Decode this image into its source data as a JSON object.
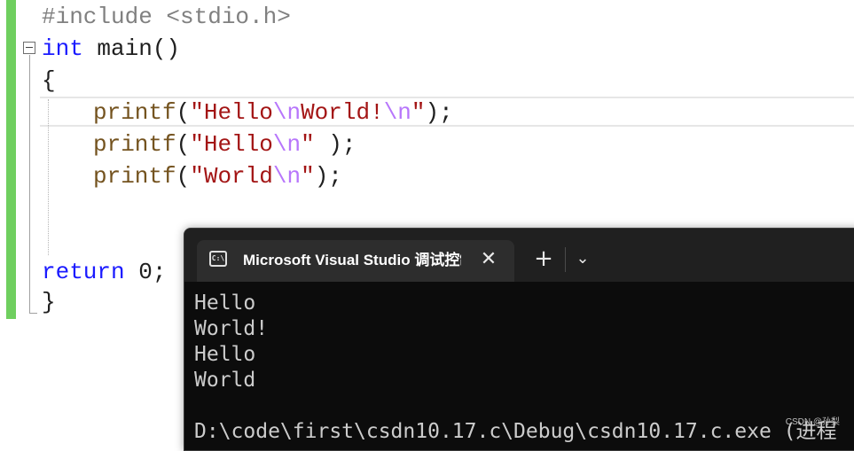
{
  "editor": {
    "line1": {
      "pre": "#include <stdio.h>"
    },
    "line2": {
      "kw": "int",
      "rest": " main()"
    },
    "line3": {
      "brace": "{"
    },
    "line4": {
      "fn": "printf",
      "p1": "(",
      "q1": "\"",
      "s1": "Hello",
      "e1": "\\n",
      "s2": "World!",
      "e2": "\\n",
      "q2": "\"",
      "end": ");"
    },
    "line5": {
      "fn": "printf",
      "p1": "(",
      "q1": "\"",
      "s1": "Hello",
      "e1": "\\n",
      "q2": "\"",
      "end": " );"
    },
    "line6": {
      "fn": "printf",
      "p1": "(",
      "q1": "\"",
      "s1": "World",
      "e1": "\\n",
      "q2": "\"",
      "end": ");"
    },
    "line9": {
      "kw": "return",
      "rest": " 0;"
    },
    "line10": {
      "brace": "}"
    }
  },
  "terminal": {
    "icon_text": "C:\\",
    "tab_title": "Microsoft Visual Studio 调试控制台",
    "close_symbol": "✕",
    "new_tab_symbol": "+",
    "dropdown_symbol": "⌄",
    "output": [
      "Hello",
      "World!",
      "Hello",
      "World",
      "",
      "D:\\code\\first\\csdn10.17.c\\Debug\\csdn10.17.c.exe (进程"
    ]
  },
  "watermark": "CSDN @孙梨",
  "icons": {
    "tab_icon": "terminal-icon",
    "close": "close-icon",
    "new_tab": "plus-icon",
    "dropdown": "chevron-down-icon"
  },
  "colors": {
    "keyword": "#1a1aff",
    "preprocessor": "#808080",
    "function": "#74531f",
    "string": "#a31515",
    "escape": "#b776fb",
    "change_bar": "#6fcf5f",
    "terminal_bg": "#0c0c0c",
    "terminal_text": "#cccccc"
  }
}
